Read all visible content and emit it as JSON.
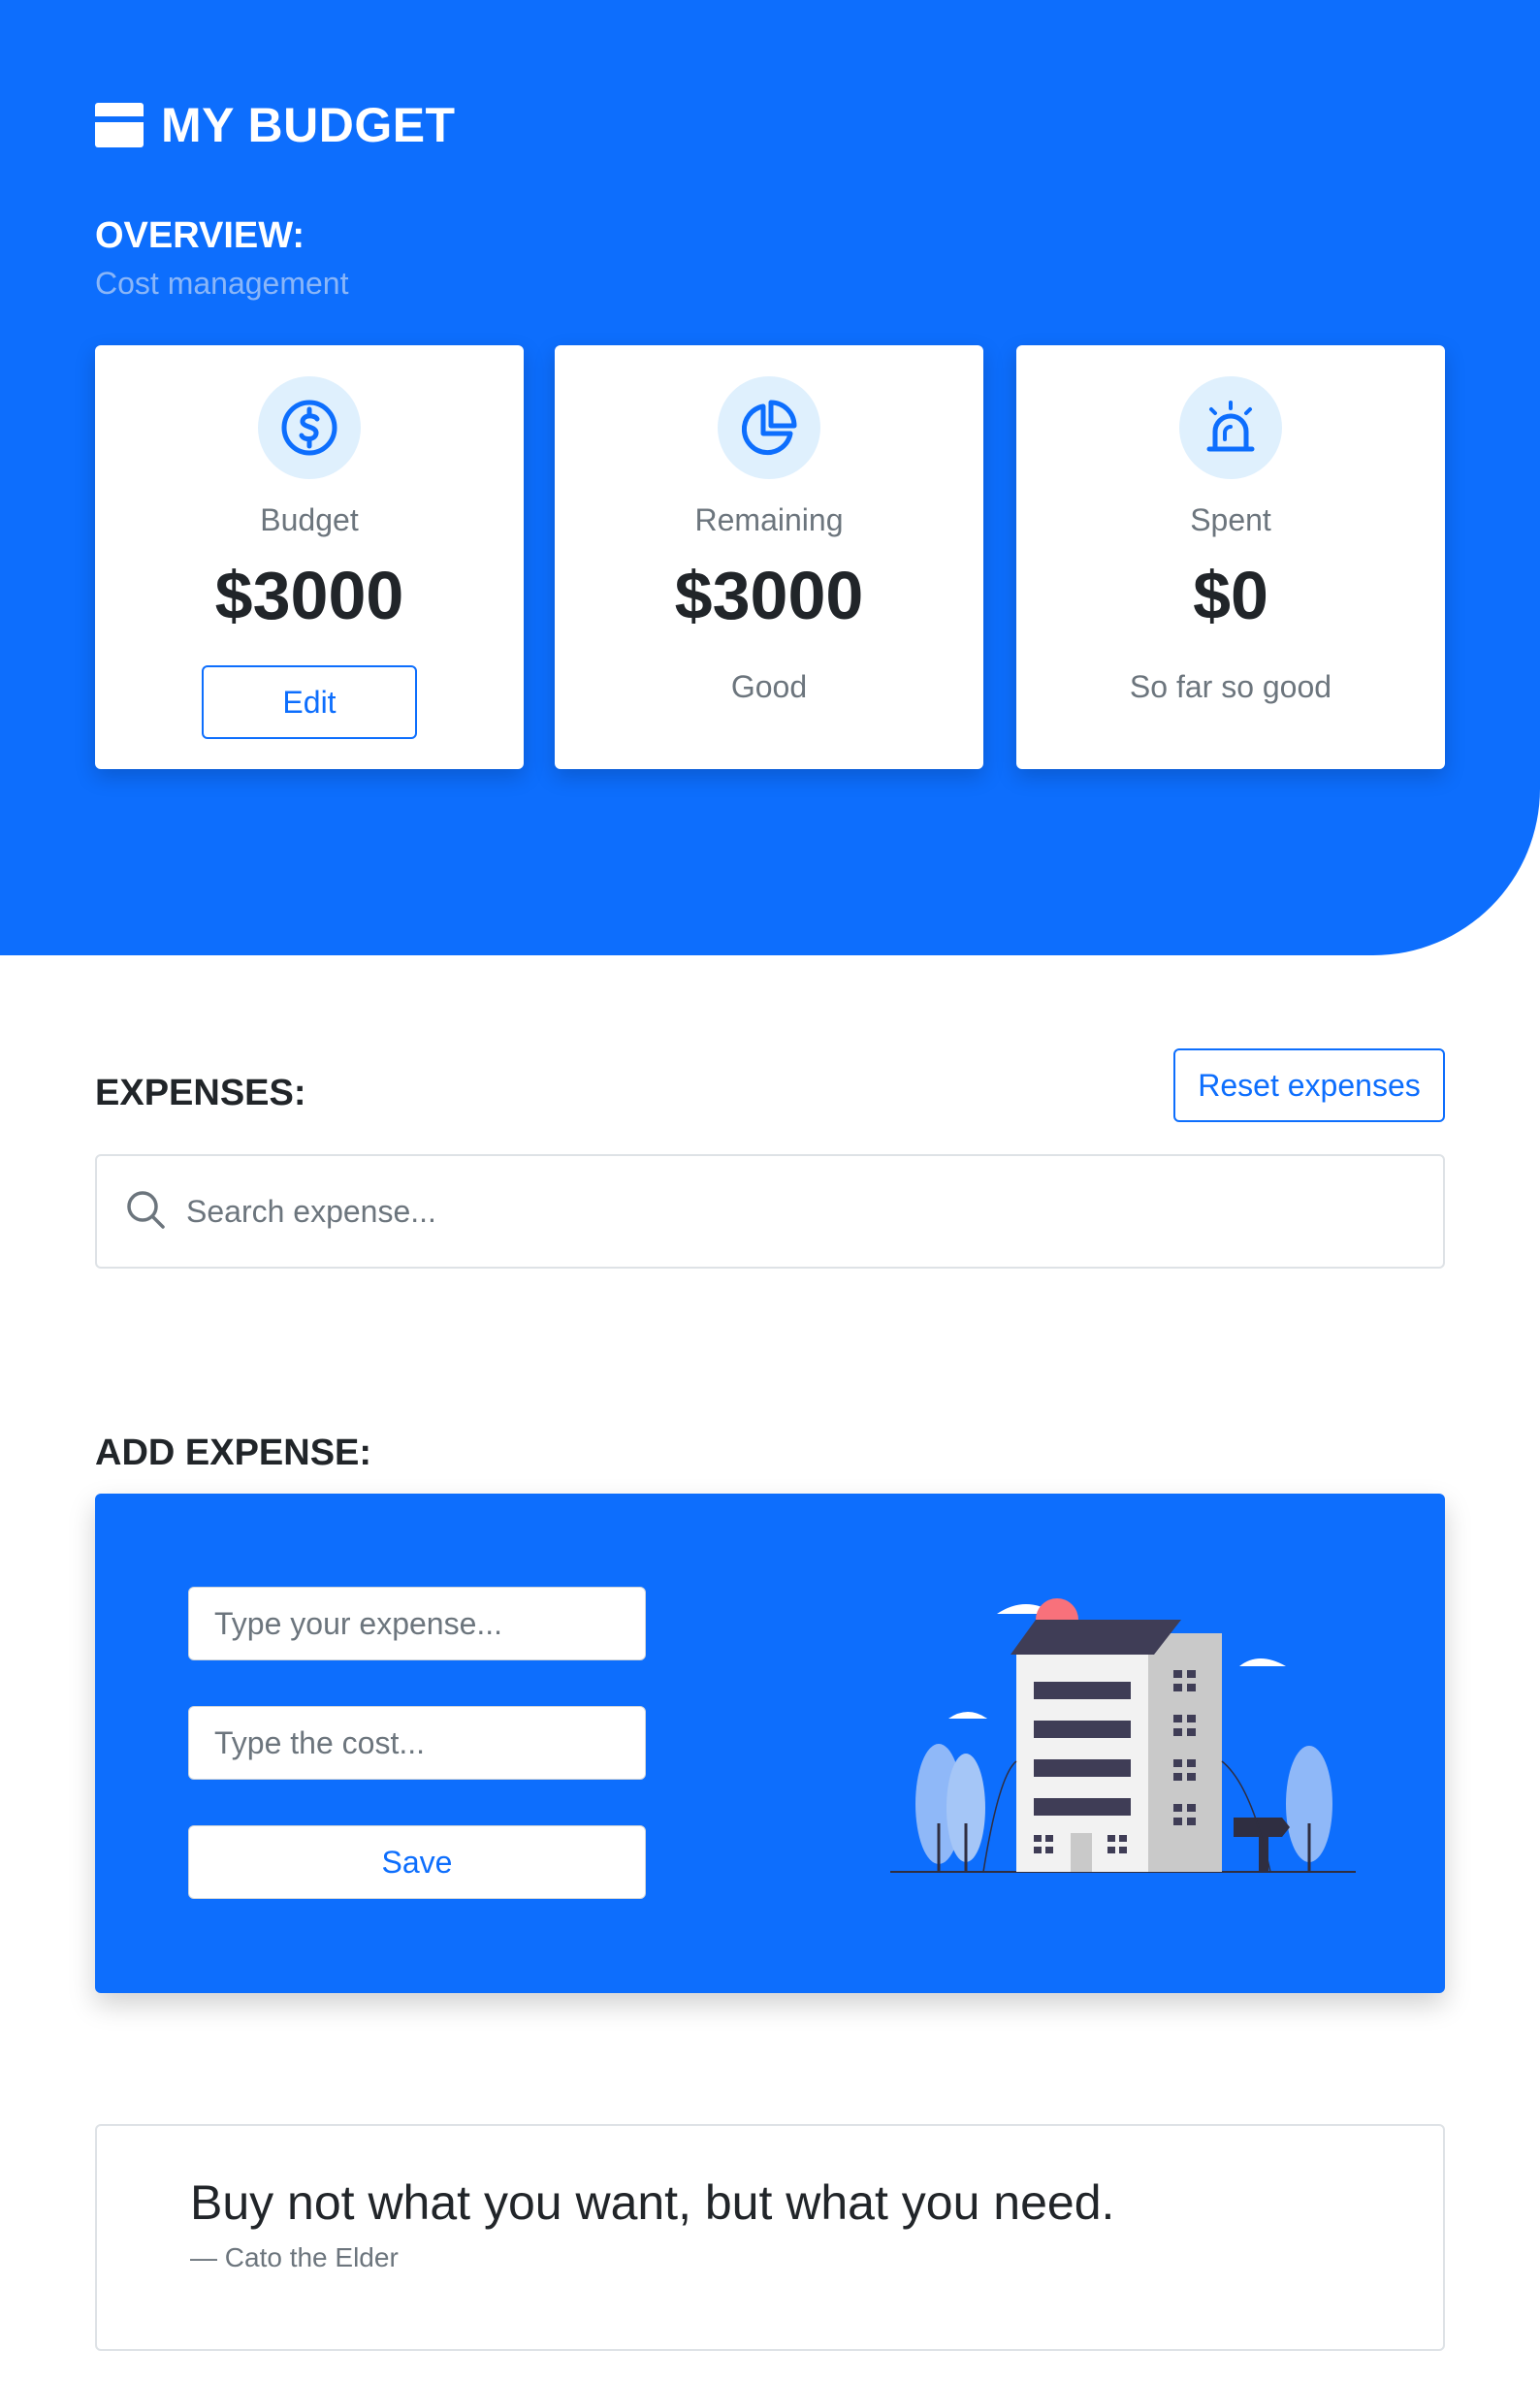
{
  "app": {
    "title": "MY BUDGET"
  },
  "overview": {
    "title": "OVERVIEW:",
    "subtitle": "Cost management",
    "cards": [
      {
        "label": "Budget",
        "amount": "$3000",
        "action": "Edit",
        "icon": "dollar-icon"
      },
      {
        "label": "Remaining",
        "amount": "$3000",
        "note": "Good",
        "icon": "pie-chart-icon"
      },
      {
        "label": "Spent",
        "amount": "$0",
        "note": "So far so good",
        "icon": "alarm-icon"
      }
    ]
  },
  "expenses": {
    "title": "EXPENSES:",
    "reset_label": "Reset expenses",
    "search_placeholder": "Search expense..."
  },
  "add_expense": {
    "title": "ADD EXPENSE:",
    "expense_placeholder": "Type your expense...",
    "cost_placeholder": "Type the cost...",
    "save_label": "Save"
  },
  "quote": {
    "text": "Buy not what you want, but what you need.",
    "author": "— Cato the Elder"
  },
  "colors": {
    "primary": "#0d6efd",
    "icon_bg": "#dff0fd",
    "muted": "#6c757d"
  }
}
